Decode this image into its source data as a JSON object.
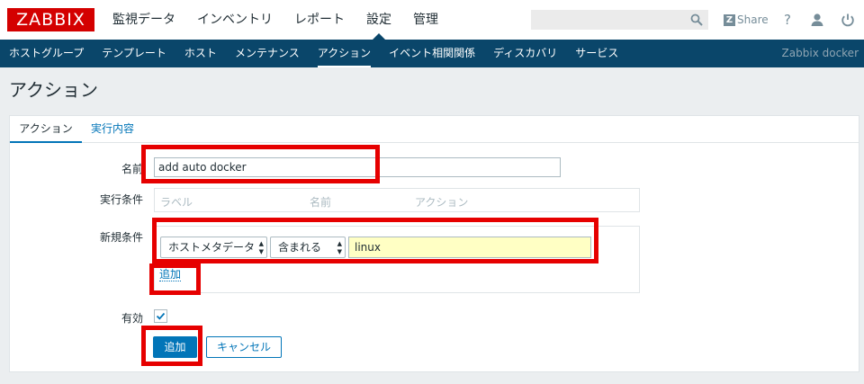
{
  "header": {
    "logo": "ZABBIX",
    "menu": [
      {
        "label": "監視データ"
      },
      {
        "label": "インベントリ"
      },
      {
        "label": "レポート"
      },
      {
        "label": "設定",
        "active": true
      },
      {
        "label": "管理"
      }
    ],
    "search": {
      "value": "",
      "icon": "search-icon"
    },
    "share_label": "Share",
    "share_badge": "Z",
    "help_glyph": "?",
    "icons": [
      "help-icon",
      "user-icon",
      "power-icon"
    ]
  },
  "subnav": {
    "items": [
      {
        "label": "ホストグループ"
      },
      {
        "label": "テンプレート"
      },
      {
        "label": "ホスト"
      },
      {
        "label": "メンテナンス"
      },
      {
        "label": "アクション",
        "active": true
      },
      {
        "label": "イベント相関関係"
      },
      {
        "label": "ディスカバリ"
      },
      {
        "label": "サービス"
      }
    ],
    "server_name": "Zabbix docker"
  },
  "page": {
    "title": "アクション"
  },
  "form": {
    "tabs": [
      {
        "label": "アクション",
        "active": true
      },
      {
        "label": "実行内容"
      }
    ],
    "name_label": "名前",
    "name_value": "add auto docker",
    "conditions_label": "実行条件",
    "conditions_columns": [
      "ラベル",
      "名前",
      "アクション"
    ],
    "new_condition_label": "新規条件",
    "new_condition": {
      "type": "ホストメタデータ",
      "operator": "含まれる",
      "value": "linux"
    },
    "add_link": "追加",
    "enabled_label": "有効",
    "enabled": true,
    "submit_label": "追加",
    "cancel_label": "キャンセル"
  },
  "colors": {
    "brand": "#d40000",
    "nav_bg": "#0a466a",
    "link": "#0275b8",
    "highlight": "#e60000",
    "value_bg": "#ffffc4"
  }
}
